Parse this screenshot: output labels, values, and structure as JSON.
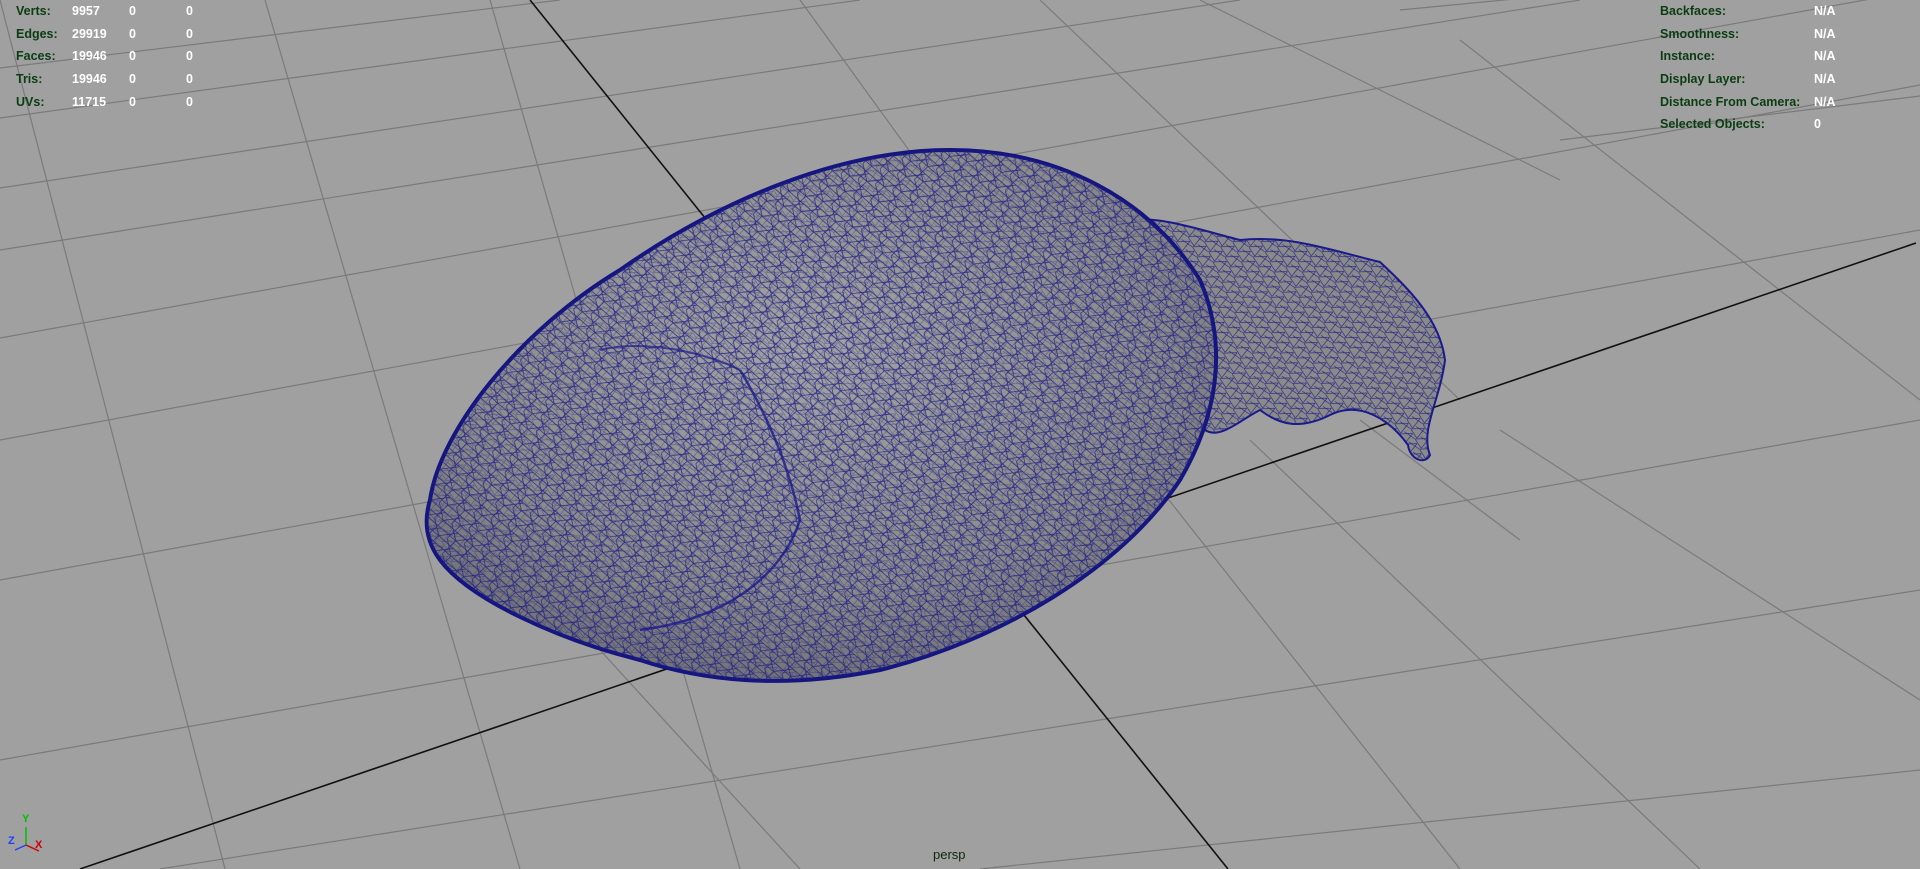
{
  "poly_count": {
    "rows": [
      {
        "label": "Verts:",
        "c1": "9957",
        "c2": "0",
        "c3": "0"
      },
      {
        "label": "Edges:",
        "c1": "29919",
        "c2": "0",
        "c3": "0"
      },
      {
        "label": "Faces:",
        "c1": "19946",
        "c2": "0",
        "c3": "0"
      },
      {
        "label": "Tris:",
        "c1": "19946",
        "c2": "0",
        "c3": "0"
      },
      {
        "label": "UVs:",
        "c1": "11715",
        "c2": "0",
        "c3": "0"
      }
    ]
  },
  "object_details": {
    "rows": [
      {
        "label": "Backfaces:",
        "value": "N/A"
      },
      {
        "label": "Smoothness:",
        "value": "N/A"
      },
      {
        "label": "Instance:",
        "value": "N/A"
      },
      {
        "label": "Display Layer:",
        "value": "N/A"
      },
      {
        "label": "Distance From Camera:",
        "value": "N/A"
      },
      {
        "label": "Selected Objects:",
        "value": "0"
      }
    ]
  },
  "camera": {
    "name": "persp"
  },
  "axis": {
    "x": "X",
    "y": "Y",
    "z": "Z"
  },
  "colors": {
    "viewport_bg": "#a0a0a0",
    "grid_line": "#7a7a7a",
    "grid_axis": "#111111",
    "wireframe": "#1a1a8c",
    "mesh_fill": "#8e8e8e",
    "hud_label": "#0a3d12",
    "hud_value": "#ffffff"
  }
}
